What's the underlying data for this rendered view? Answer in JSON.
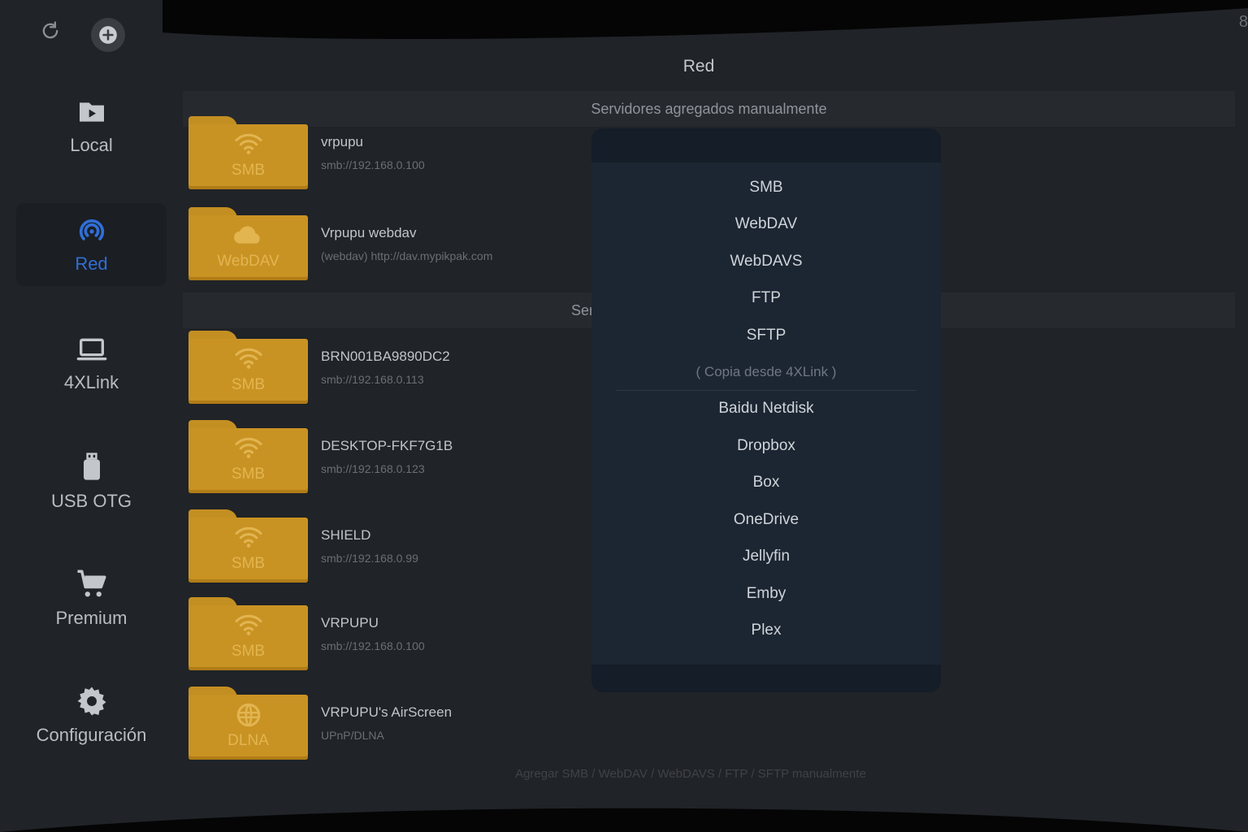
{
  "topbar": {
    "refresh_icon": "refresh-icon",
    "add_icon": "add-circle-icon",
    "corner_digit": "8"
  },
  "sidebar": {
    "items": [
      {
        "label": "Local",
        "icon": "play-folder-icon",
        "active": false
      },
      {
        "label": "Red",
        "icon": "network-signal-icon",
        "active": true
      },
      {
        "label": "4XLink",
        "icon": "laptop-icon",
        "active": false
      },
      {
        "label": "USB OTG",
        "icon": "usb-drive-icon",
        "active": false
      },
      {
        "label": "Premium",
        "icon": "cart-icon",
        "active": false
      },
      {
        "label": "Configuración",
        "icon": "gear-icon",
        "active": false
      }
    ]
  },
  "main": {
    "title": "Red",
    "section_manual": "Servidores agregados manualmente",
    "section_lan": "Ser",
    "manual_servers": [
      {
        "type": "SMB",
        "name": "vrpupu",
        "address": "smb://192.168.0.100"
      },
      {
        "type": "WebDAV",
        "name": "Vrpupu webdav",
        "address": "(webdav) http://dav.mypikpak.com"
      }
    ],
    "lan_servers": [
      {
        "type": "SMB",
        "name": "BRN001BA9890DC2",
        "address": "smb://192.168.0.113"
      },
      {
        "type": "SMB",
        "name": "DESKTOP-FKF7G1B",
        "address": "smb://192.168.0.123"
      },
      {
        "type": "SMB",
        "name": "SHIELD",
        "address": "smb://192.168.0.99"
      },
      {
        "type": "SMB",
        "name": "VRPUPU",
        "address": "smb://192.168.0.100"
      },
      {
        "type": "DLNA",
        "name": "VRPUPU's AirScreen",
        "address": "UPnP/DLNA"
      }
    ],
    "footer_hint": "Agregar SMB / WebDAV / WebDAVS / FTP / SFTP manualmente"
  },
  "dialog": {
    "protocols": [
      "SMB",
      "WebDAV",
      "WebDAVS",
      "FTP",
      "SFTP"
    ],
    "copy_note": "( Copia desde 4XLink )",
    "cloud_services": [
      "Baidu Netdisk",
      "Dropbox",
      "Box",
      "OneDrive",
      "Jellyfin",
      "Emby",
      "Plex"
    ]
  },
  "colors": {
    "accent": "#2f6fd8",
    "folder": "#c99323",
    "dialog_bg": "#1c2632",
    "panel_bg": "#202327"
  }
}
